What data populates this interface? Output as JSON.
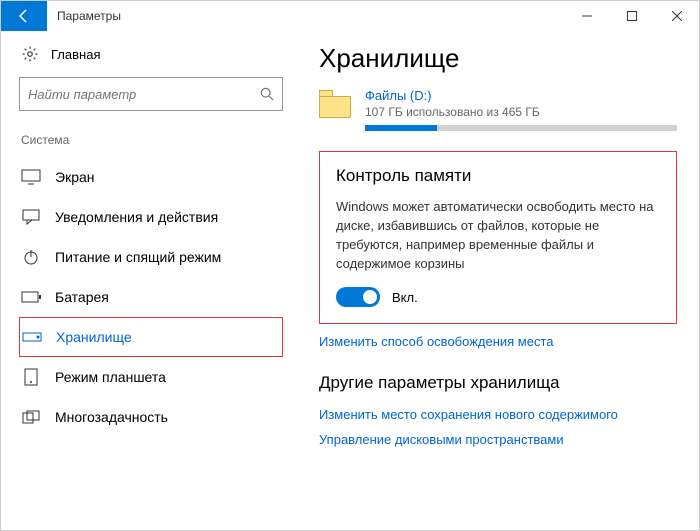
{
  "window": {
    "title": "Параметры"
  },
  "sidebar": {
    "home": "Главная",
    "search_placeholder": "Найти параметр",
    "section": "Система",
    "items": [
      {
        "label": "Экран"
      },
      {
        "label": "Уведомления и действия"
      },
      {
        "label": "Питание и спящий режим"
      },
      {
        "label": "Батарея"
      },
      {
        "label": "Хранилище"
      },
      {
        "label": "Режим планшета"
      },
      {
        "label": "Многозадачность"
      }
    ]
  },
  "main": {
    "heading": "Хранилище",
    "drive": {
      "name": "Файлы (D:)",
      "usage": "107 ГБ использовано из 465 ГБ",
      "used_gb": 107,
      "total_gb": 465
    },
    "storage_sense": {
      "title": "Контроль памяти",
      "description": "Windows может автоматически освободить место на диске, избавившись от файлов, которые не требуются, например временные файлы и содержимое корзины",
      "toggle_state": "Вкл.",
      "toggle_on": true
    },
    "change_link": "Изменить способ освобождения места",
    "other_heading": "Другие параметры хранилища",
    "save_location_link": "Изменить место сохранения нового содержимого",
    "manage_spaces_link": "Управление дисковыми пространствами"
  }
}
